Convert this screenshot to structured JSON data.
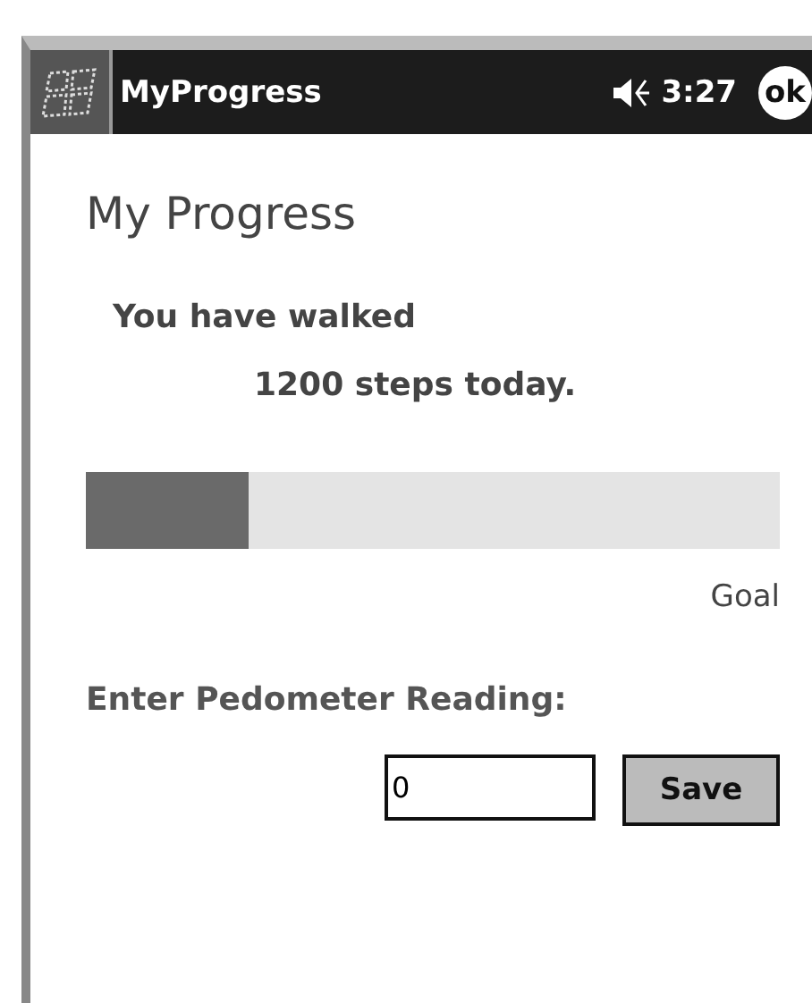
{
  "title_bar": {
    "title": "MyProgress",
    "time": "3:27",
    "ok_button": "ok"
  },
  "page": {
    "heading": "My Progress",
    "line_1": "You have walked",
    "line_2": "1200  steps today."
  },
  "progress": {
    "level": 0.235,
    "end_label": "Goal"
  },
  "entry": {
    "label": "Enter Pedometer Reading:",
    "value": "0",
    "button": "Save"
  }
}
